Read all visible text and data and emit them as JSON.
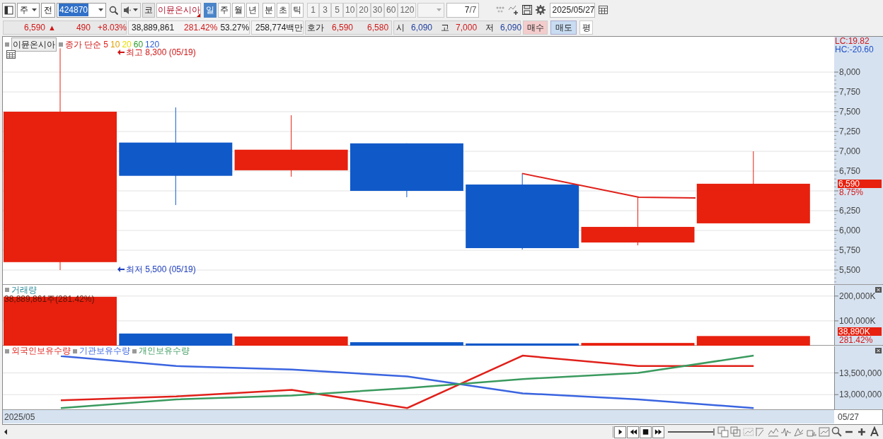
{
  "toolbar": {
    "market": "주",
    "prev_button": "전",
    "code": "424870",
    "stock_label": "코",
    "stock_name": "이뮨온시아",
    "periods": [
      {
        "label": "일",
        "selected": true
      },
      {
        "label": "주",
        "selected": false
      },
      {
        "label": "월",
        "selected": false
      },
      {
        "label": "년",
        "selected": false
      },
      {
        "label": "분",
        "selected": false
      },
      {
        "label": "초",
        "selected": false
      },
      {
        "label": "틱",
        "selected": false
      }
    ],
    "intervals": [
      "1",
      "3",
      "5",
      "10",
      "20",
      "30",
      "60",
      "120"
    ],
    "count": "7",
    "count_total": "/7",
    "date": "2025/05/27"
  },
  "quote": {
    "price": "6,590",
    "arrow": "▲",
    "change": "490",
    "change_rate": "+8.03%",
    "volume": "38,889,861",
    "volume_rate": "281.42%",
    "turnover_rate": "53.27%",
    "amount": "258,774백만",
    "bid_label": "호가",
    "ask": "6,590",
    "bid": "6,580",
    "open_label": "시",
    "open": "6,090",
    "high_label": "고",
    "high": "7,000",
    "low_label": "저",
    "low": "6,090",
    "buy": "매수",
    "sell": "매도",
    "avg": "평"
  },
  "price_panel": {
    "stock_name": "이뮨온시아",
    "ma_label": "종가 단순",
    "ma_periods": [
      {
        "label": "5",
        "color": "#e0201a"
      },
      {
        "label": "10",
        "color": "#e0a000"
      },
      {
        "label": "20",
        "color": "#e6e000"
      },
      {
        "label": "60",
        "color": "#2a9a2a"
      },
      {
        "label": "120",
        "color": "#2a5ad0"
      }
    ],
    "high_note": "최고 8,300 (05/19)",
    "low_note": "최저 5,500 (05/19)",
    "lc": "LC:19.82",
    "hc": "HC:-20.60",
    "ticks": [
      "8,000",
      "7,750",
      "7,500",
      "7,250",
      "7,000",
      "6,750",
      "6,250",
      "6,000",
      "5,750",
      "5,500"
    ],
    "price_badge": "6,590",
    "price_rate": "8.75%"
  },
  "volume_panel": {
    "label": "38,889,861주(281.42%)",
    "badge": "38,890K",
    "badge_rate": "281.42%",
    "chart_data": {
      "type": "bar",
      "title": "거래량",
      "ylim": [
        0,
        245000
      ],
      "yticks": [
        {
          "value": 100000,
          "label": "100,000K"
        },
        {
          "value": 200000,
          "label": "200,000K"
        }
      ],
      "series": [
        {
          "color": "#e8200e",
          "values": [
            197000,
            null,
            37000,
            null,
            null,
            11000,
            38890
          ]
        },
        {
          "color": "#1059c8",
          "values": [
            null,
            49000,
            null,
            14000,
            9000,
            null,
            null
          ]
        }
      ]
    }
  },
  "holdings_panel": {
    "chart_data": {
      "type": "line",
      "ylim": [
        12645000,
        14129000
      ],
      "yticks": [
        {
          "value": 13000000,
          "label": "13,000,000"
        },
        {
          "value": 13500000,
          "label": "13,500,000"
        }
      ],
      "series": [
        {
          "name": "외국인보유수량",
          "color": "#e0201a",
          "values": [
            12870000,
            12960000,
            13110000,
            12690000,
            13900000,
            13660000,
            13660000
          ]
        },
        {
          "name": "기관보유수량",
          "color": "#3a64e0",
          "values": [
            13890000,
            13660000,
            13580000,
            13420000,
            13030000,
            12890000,
            12690000
          ]
        },
        {
          "name": "개인보유수량",
          "color": "#3a9a5e",
          "values": [
            12690000,
            12890000,
            12980000,
            13150000,
            13360000,
            13500000,
            13900000
          ]
        }
      ]
    }
  },
  "date_row": {
    "start": "2025/05",
    "end": "05/27"
  },
  "zoom_slider": {
    "level": 1
  }
}
